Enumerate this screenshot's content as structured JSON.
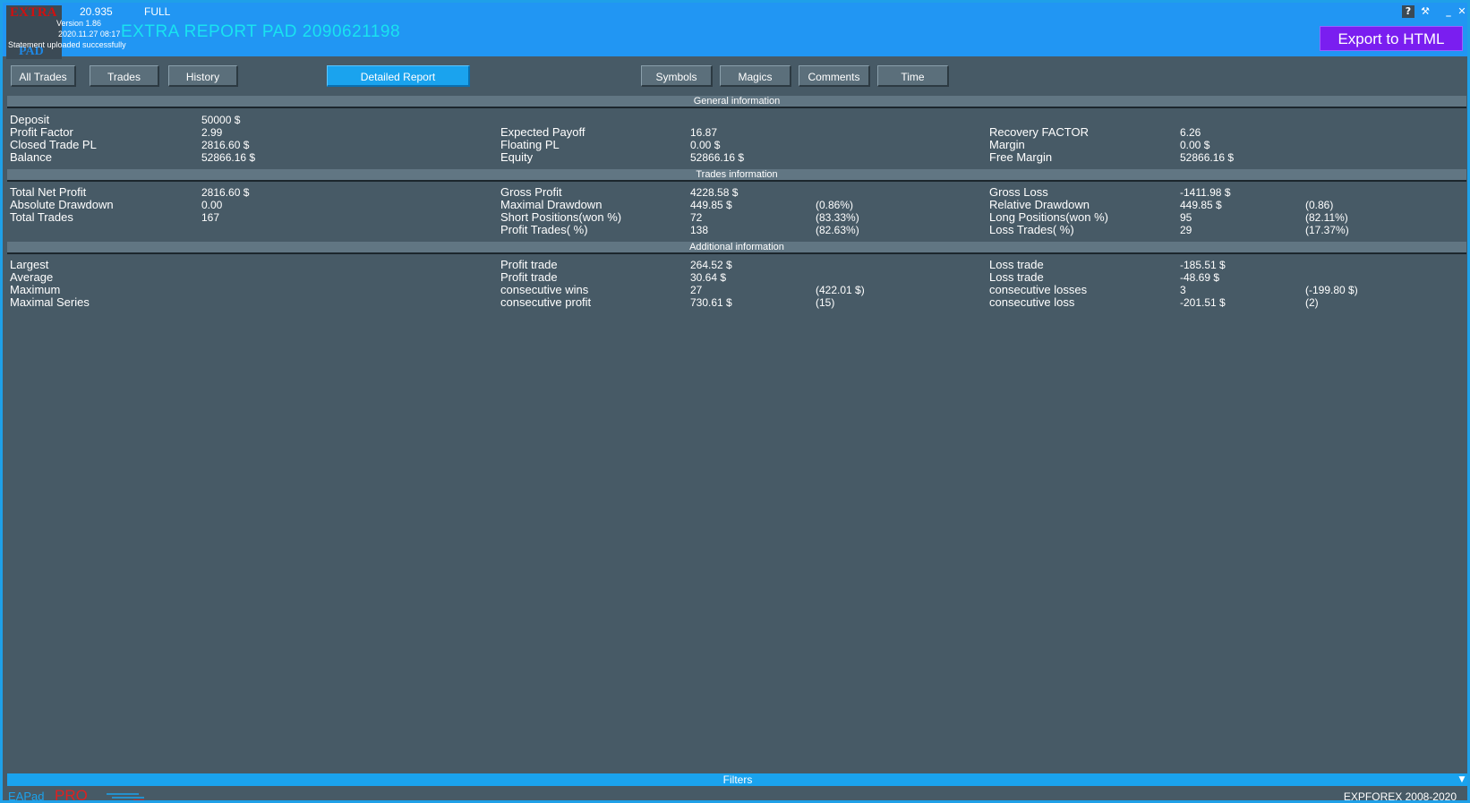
{
  "titlebar": {
    "logo_top": "EXTRA",
    "logo_bottom": "PAD",
    "build": "20.935",
    "mode": "FULL",
    "version_line": "Version 1.86",
    "date_line": "2020.11.27 08:17",
    "status_line": "Statement uploaded successfully",
    "title": "EXTRA REPORT PAD 2090621198",
    "help": "?",
    "settings": "⚒",
    "minimize": "_",
    "close": "✕",
    "export_label": "Export to HTML"
  },
  "tabs": [
    "All Trades",
    "Trades",
    "History",
    "Detailed Report",
    "Symbols",
    "Magics",
    "Comments",
    "Time"
  ],
  "active_tab": "Detailed Report",
  "sections": {
    "general": {
      "title": "General information",
      "col1": [
        [
          "Deposit",
          "50000 $"
        ],
        [
          "Profit Factor",
          "2.99"
        ],
        [
          "Closed Trade PL",
          "2816.60 $"
        ],
        [
          "Balance",
          "52866.16 $"
        ]
      ],
      "col2": [
        [
          "Expected Payoff",
          "16.87"
        ],
        [
          "Floating PL",
          "0.00 $"
        ],
        [
          "Equity",
          "52866.16 $"
        ]
      ],
      "col3": [
        [
          "Recovery FACTOR",
          "6.26"
        ],
        [
          "Margin",
          "0.00 $"
        ],
        [
          "Free Margin",
          "52866.16 $"
        ]
      ]
    },
    "trades": {
      "title": "Trades information",
      "col1": [
        [
          "Total Net Profit",
          "2816.60 $"
        ],
        [
          "Absolute Drawdown",
          "0.00"
        ],
        [
          "Total Trades",
          "167"
        ]
      ],
      "col2": [
        [
          "Gross Profit",
          "4228.58 $",
          ""
        ],
        [
          "Maximal Drawdown",
          "449.85 $",
          "(0.86%)"
        ],
        [
          "Short Positions(won %)",
          "72",
          "(83.33%)"
        ],
        [
          "Profit Trades( %)",
          "138",
          "(82.63%)"
        ]
      ],
      "col3": [
        [
          "Gross Loss",
          "-1411.98 $",
          ""
        ],
        [
          "Relative Drawdown",
          "449.85 $",
          "(0.86)"
        ],
        [
          "Long Positions(won %)",
          "95",
          "(82.11%)"
        ],
        [
          "Loss Trades( %)",
          "29",
          "(17.37%)"
        ]
      ]
    },
    "additional": {
      "title": "Additional information",
      "col1": [
        "Largest",
        "Average",
        "Maximum",
        "Maximal Series"
      ],
      "col2": [
        [
          "Profit trade",
          "264.52 $",
          ""
        ],
        [
          "Profit trade",
          "30.64 $",
          ""
        ],
        [
          "consecutive wins",
          "27",
          "(422.01 $)"
        ],
        [
          "consecutive profit",
          "730.61 $",
          "(15)"
        ]
      ],
      "col3": [
        [
          "Loss trade",
          "-185.51 $",
          ""
        ],
        [
          "Loss trade",
          "-48.69 $",
          ""
        ],
        [
          "consecutive losses",
          "3",
          "(-199.80 $)"
        ],
        [
          "consecutive loss",
          "-201.51 $",
          "(2)"
        ]
      ]
    }
  },
  "filters_label": "Filters",
  "filters_arrow": "▼",
  "footer": {
    "brand_left": "EAPad",
    "brand_right": "PRO",
    "copyright": "EXPFOREX 2008-2020"
  }
}
